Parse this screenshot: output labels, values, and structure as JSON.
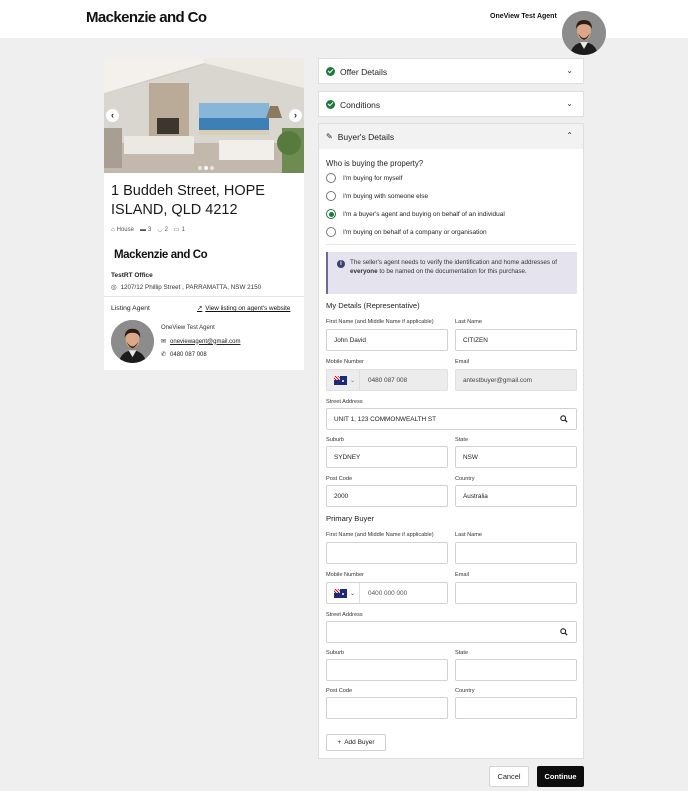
{
  "header": {
    "brand": "Mackenzie and Co",
    "agent_name": "OneView Test Agent"
  },
  "listing": {
    "address": "1 Buddeh Street, HOPE ISLAND, QLD 4212",
    "property_type": "House",
    "bedrooms": "3",
    "bathrooms": "2",
    "parking": "1",
    "agency_brand": "Mackenzie and Co",
    "office_name": "TestRT Office",
    "office_address": "1207/12 Phillip Street , PARRAMATTA, NSW 2150",
    "listing_agent_label": "Listing Agent",
    "view_link": "View listing on agent's website",
    "agent_name": "OneView Test Agent",
    "agent_email": "oneviewagent@gmail.com",
    "agent_phone": "0480 087 008",
    "photo_count": 3,
    "active_photo": 2
  },
  "accordion": {
    "offer_details": "Offer Details",
    "conditions": "Conditions",
    "buyers_details": "Buyer's Details"
  },
  "buyers": {
    "question": "Who is buying the property?",
    "options": [
      "I'm buying for myself",
      "I'm buying with someone else",
      "I'm a buyer's agent and buying on behalf of an individual",
      "I'm buying on behalf of a company or organisation"
    ],
    "selected_option": 2,
    "info_pre": "The seller's agent needs to verify the identification and home addresses of ",
    "info_bold": "everyone",
    "info_post": " to be named on the documentation for this purchase.",
    "my_details_title": "My Details (Representative)",
    "labels": {
      "first_name": "First Name (and Middle Name if applicable)",
      "last_name": "Last Name",
      "mobile": "Mobile Number",
      "email": "Email",
      "street": "Street Address",
      "suburb": "Suburb",
      "state": "State",
      "post_code": "Post Code",
      "country": "Country"
    },
    "rep": {
      "first_name": "John David",
      "last_name": "CITIZEN",
      "mobile": "0480 087 008",
      "email": "antestbuyer@gmail.com",
      "street": "UNIT 1, 123 COMMONWEALTH ST",
      "suburb": "SYDNEY",
      "state": "NSW",
      "post_code": "2000",
      "country": "Australia"
    },
    "primary_title": "Primary Buyer",
    "primary": {
      "mobile_placeholder": "0400 000 000"
    },
    "add_buyer": "Add Buyer"
  },
  "footer": {
    "cancel": "Cancel",
    "continue": "Continue"
  },
  "colors": {
    "accent_green": "#1e7a3a",
    "info_bg": "#e4e3ee",
    "primary_button": "#0d0d0d"
  }
}
